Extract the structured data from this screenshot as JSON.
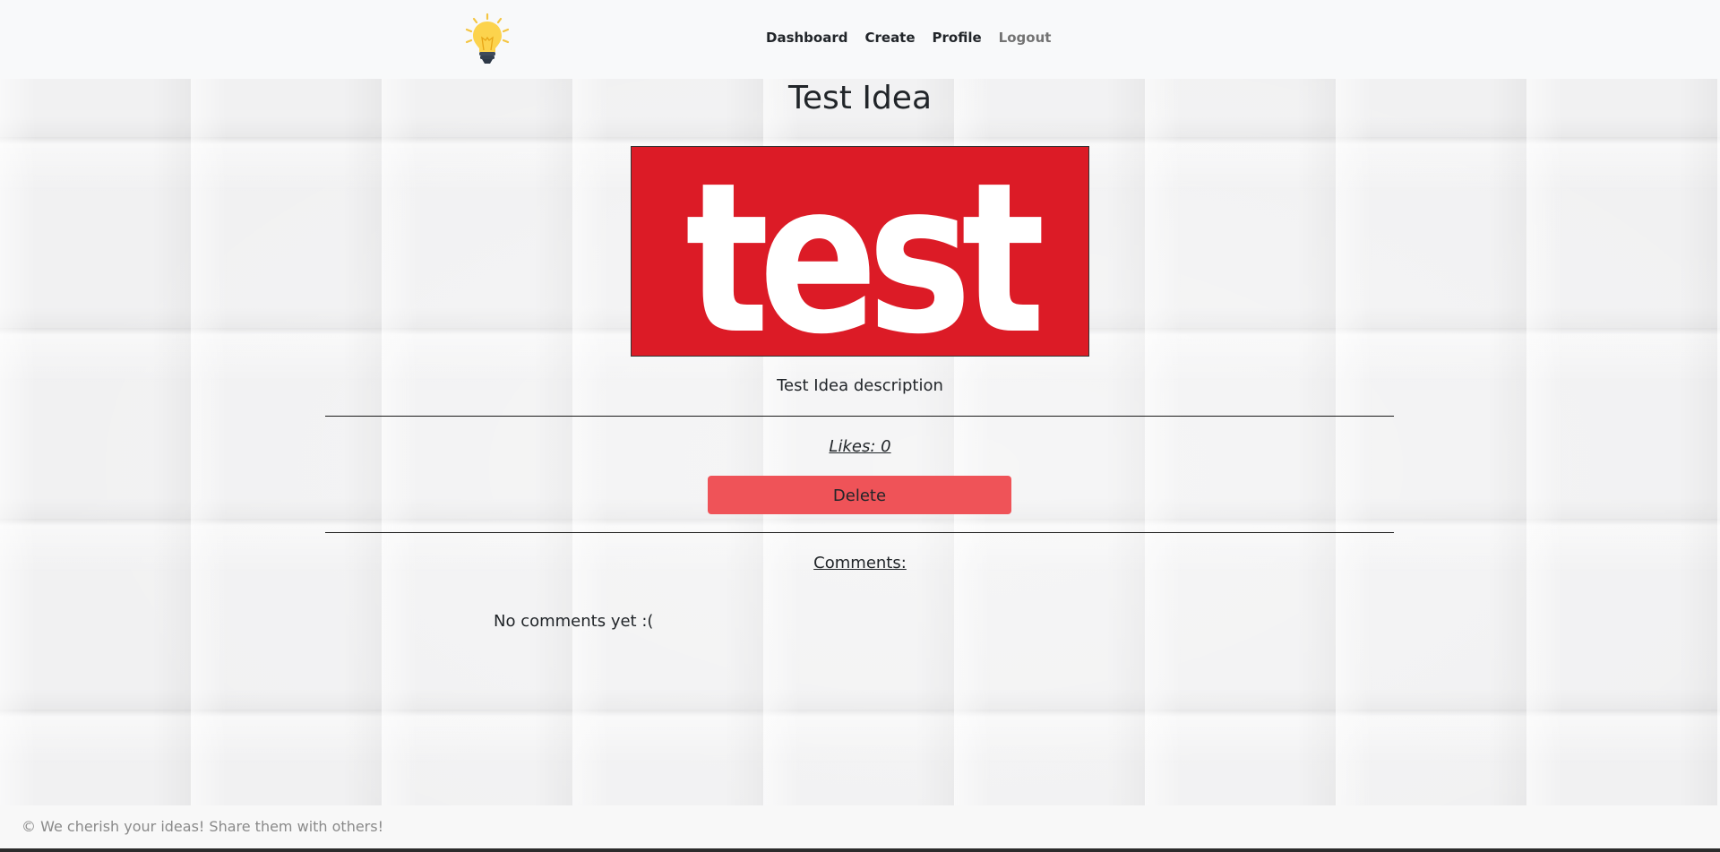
{
  "nav": {
    "logo_icon": "lightbulb-icon",
    "links": [
      "Dashboard",
      "Create",
      "Profile"
    ],
    "logout": "Logout"
  },
  "idea": {
    "title": "Test Idea",
    "image_text": "test",
    "description": "Test Idea description",
    "likes": "Likes: 0",
    "delete_label": "Delete"
  },
  "comments": {
    "heading": "Comments:",
    "empty_text": "No comments yet :("
  },
  "footer": {
    "text": "© We cherish your ideas! Share them with others!"
  },
  "colors": {
    "image_bg": "#dc1b26",
    "delete_bg": "#ef5358",
    "bulb": "#fcd34d"
  }
}
